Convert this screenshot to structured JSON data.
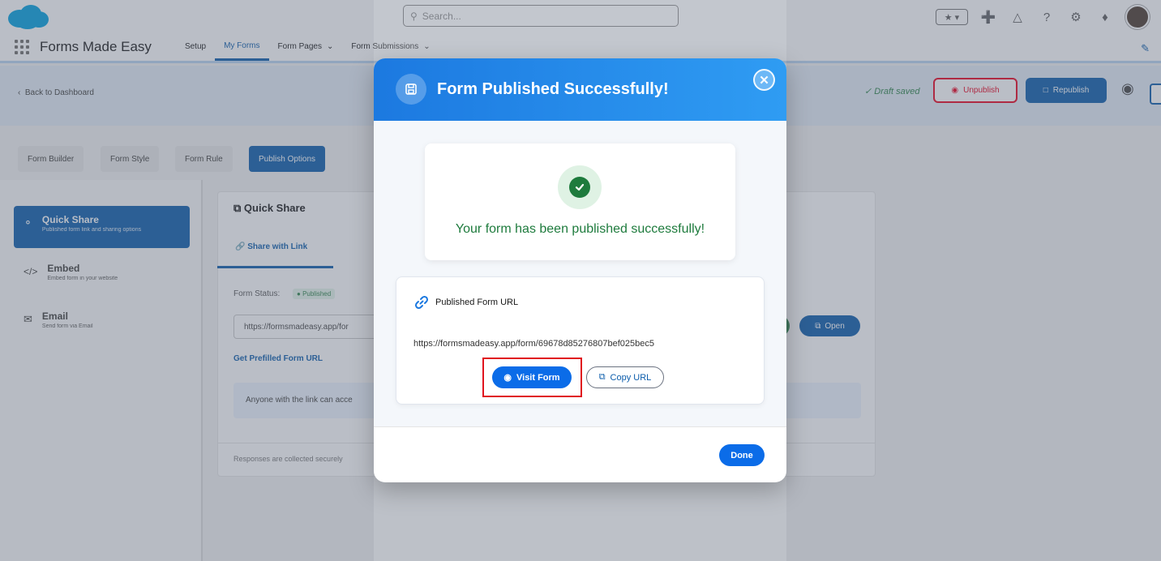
{
  "global_header": {
    "search_placeholder": "Search..."
  },
  "app_nav": {
    "app_name": "Forms Made Easy",
    "items": [
      {
        "label": "Setup"
      },
      {
        "label": "My Forms"
      },
      {
        "label": "Form Pages"
      },
      {
        "label": "Form Submissions"
      }
    ]
  },
  "subheader": {
    "back_label": "Back to Dashboard",
    "draft_status": "Draft saved",
    "unpublish_label": "Unpublish",
    "republish_label": "Republish"
  },
  "tabs": [
    {
      "label": "Form Builder"
    },
    {
      "label": "Form Style"
    },
    {
      "label": "Form Rule"
    },
    {
      "label": "Publish Options"
    }
  ],
  "sidebar": {
    "items": [
      {
        "title": "Quick Share",
        "desc": "Published form link and sharing options"
      },
      {
        "title": "Embed",
        "desc": "Embed form in your website"
      },
      {
        "title": "Email",
        "desc": "Send form via Email"
      }
    ]
  },
  "panel": {
    "title": "Quick Share",
    "share_tab": "Share with Link",
    "form_status_label": "Form Status:",
    "status_badge": "Published",
    "url_value": "https://formsmadeasy.app/for",
    "open_label": "Open",
    "prefill_link": "Get Prefilled Form URL",
    "info_text": "Anyone with the link can acce",
    "footer_text": "Responses are collected securely"
  },
  "modal": {
    "title": "Form Published Successfully!",
    "success_message": "Your form has been published successfully!",
    "url_section_title": "Published Form URL",
    "form_url": "https://formsmadeasy.app/form/69678d85276807bef025bec5",
    "visit_label": "Visit Form",
    "copy_label": "Copy URL",
    "done_label": "Done"
  },
  "colors": {
    "brand": "#0b5cab",
    "modal_header": "#1c79e0",
    "success": "#1e7b3d",
    "highlight": "#e0141e"
  }
}
